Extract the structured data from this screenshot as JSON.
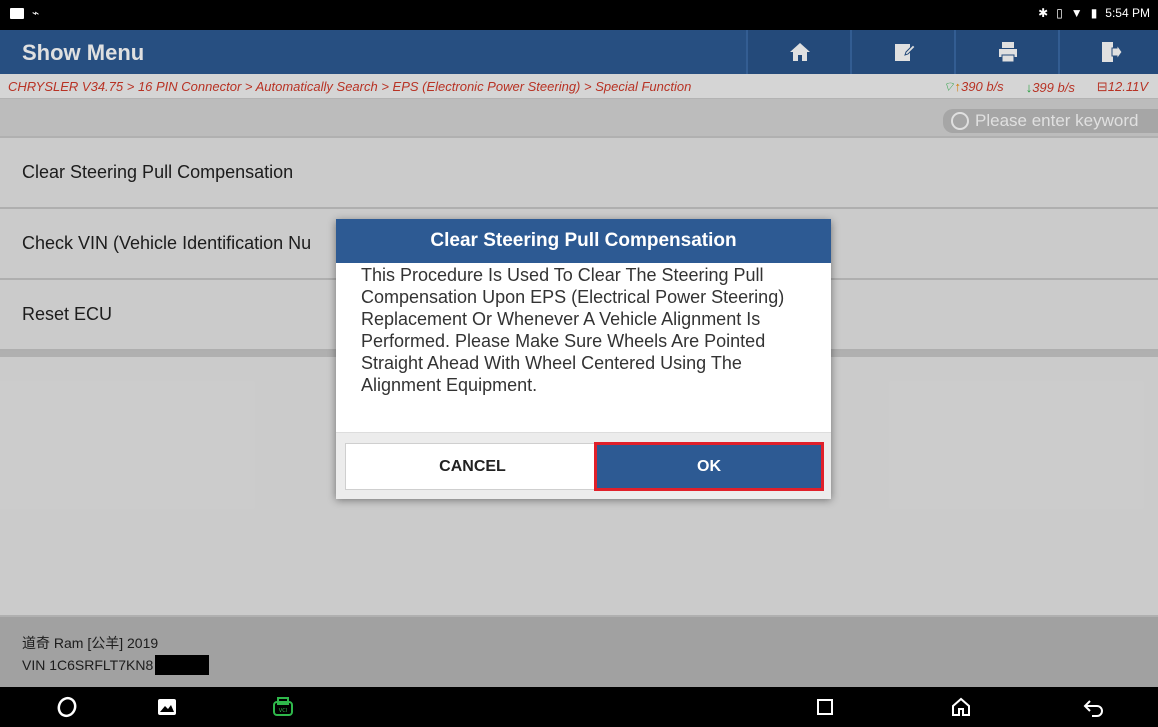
{
  "status_bar": {
    "time": "5:54 PM"
  },
  "app": {
    "title": "Show Menu",
    "toolbar": {
      "home_icon": "home-icon",
      "edit_icon": "edit-icon",
      "print_icon": "print-icon",
      "exit_icon": "exit-icon"
    }
  },
  "breadcrumb": {
    "path": "CHRYSLER V34.75 > 16 PIN Connector > Automatically Search > EPS (Electronic Power Steering) > Special Function",
    "upload_speed": "390 b/s",
    "download_speed": "399 b/s",
    "battery_voltage": "12.11V"
  },
  "search": {
    "placeholder": "Please enter keyword"
  },
  "menu": {
    "items": [
      {
        "label": "Clear Steering Pull Compensation"
      },
      {
        "label": "Check VIN (Vehicle Identification Nu"
      },
      {
        "label": "Reset ECU"
      }
    ]
  },
  "vehicle": {
    "model": "道奇 Ram [公羊] 2019",
    "vin": "VIN 1C6SRFLT7KN8"
  },
  "dialog": {
    "title": "Clear Steering Pull Compensation",
    "body": "This Procedure Is Used To Clear The Steering Pull Compensation Upon EPS (Electrical Power Steering) Replacement Or Whenever A Vehicle Alignment Is Performed.  Please Make Sure Wheels Are Pointed Straight Ahead With Wheel Centered Using The Alignment Equipment.",
    "cancel_label": "CANCEL",
    "ok_label": "OK"
  },
  "colors": {
    "header": "#2d5a93",
    "breadcrumb_text": "#d23a2a",
    "highlight": "#e0202a",
    "download_arrow": "#26b343"
  }
}
